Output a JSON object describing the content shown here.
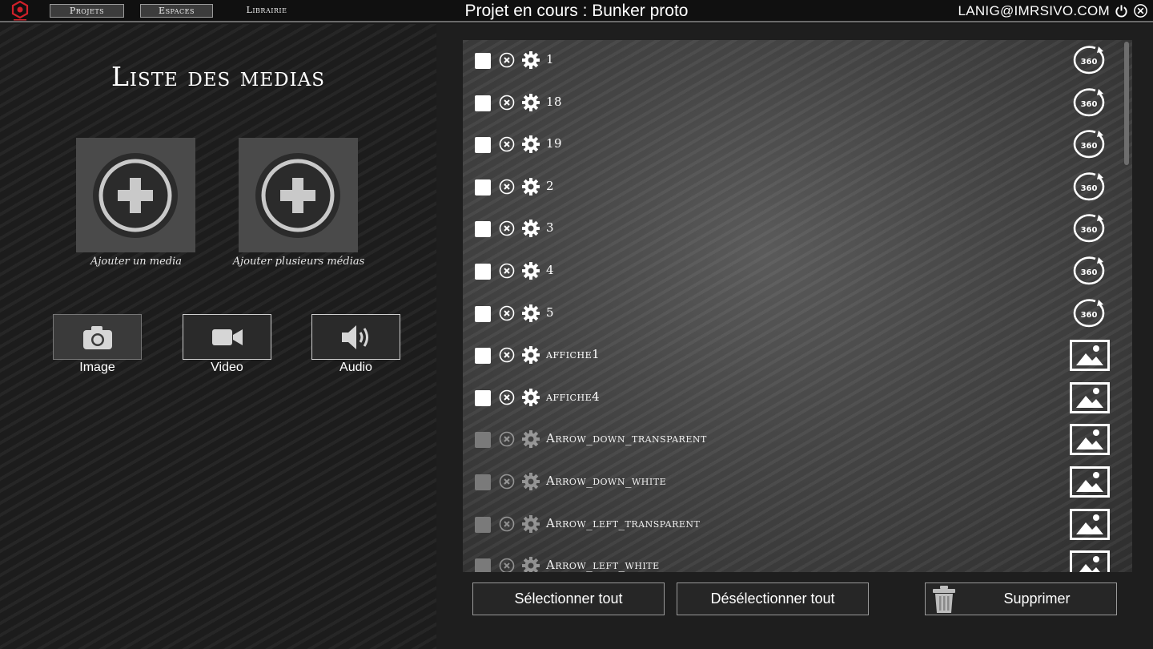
{
  "topbar": {
    "nav": {
      "projets": "Projets",
      "espaces": "Espaces",
      "librairie": "Librairie"
    },
    "project_title": "Projet en cours : Bunker proto",
    "user_email": "LANIG@IMRSIVO.COM",
    "icons": {
      "logo": "imrsivo-logo-icon",
      "power": "power-icon",
      "close": "close-icon"
    }
  },
  "left": {
    "title": "Liste des medias",
    "add_one_label": "Ajouter un media",
    "add_many_label": "Ajouter plusieurs médias",
    "types": [
      {
        "label": "Image",
        "icon": "camera-icon"
      },
      {
        "label": "Video",
        "icon": "video-camera-icon"
      },
      {
        "label": "Audio",
        "icon": "speaker-icon"
      }
    ]
  },
  "media_list": [
    {
      "label": "1",
      "type": "360",
      "enabled": true
    },
    {
      "label": "18",
      "type": "360",
      "enabled": true
    },
    {
      "label": "19",
      "type": "360",
      "enabled": true
    },
    {
      "label": "2",
      "type": "360",
      "enabled": true
    },
    {
      "label": "3",
      "type": "360",
      "enabled": true
    },
    {
      "label": "4",
      "type": "360",
      "enabled": true
    },
    {
      "label": "5",
      "type": "360",
      "enabled": true
    },
    {
      "label": "affiche1",
      "type": "image",
      "enabled": true
    },
    {
      "label": "affiche4",
      "type": "image",
      "enabled": true
    },
    {
      "label": "Arrow_down_transparent",
      "type": "image",
      "enabled": false
    },
    {
      "label": "Arrow_down_white",
      "type": "image",
      "enabled": false
    },
    {
      "label": "Arrow_left_transparent",
      "type": "image",
      "enabled": false
    },
    {
      "label": "Arrow_left_white",
      "type": "image",
      "enabled": false
    }
  ],
  "buttons": {
    "select_all": "Sélectionner tout",
    "deselect_all": "Désélectionner tout",
    "delete": "Supprimer"
  },
  "colors": {
    "background": "#1a1a1a",
    "panel": "#4a4a4a",
    "accent_logo": "#d0202a",
    "text": "#ffffff"
  }
}
